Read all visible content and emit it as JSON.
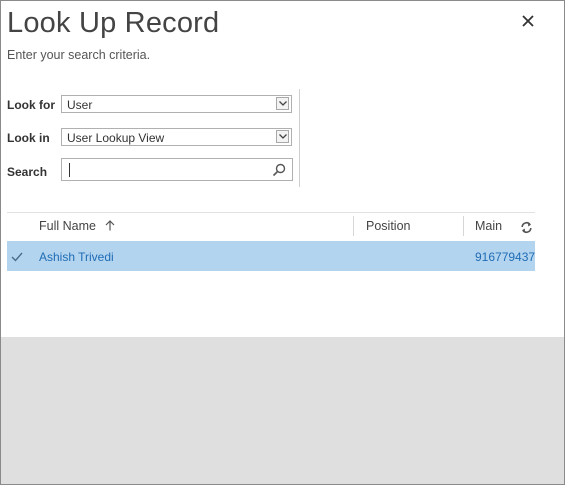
{
  "dialog": {
    "title": "Look Up Record",
    "subtitle": "Enter your search criteria.",
    "close_icon": "close-icon"
  },
  "form": {
    "look_for_label": "Look for",
    "look_for_value": "User",
    "look_in_label": "Look in",
    "look_in_value": "User Lookup View",
    "search_label": "Search",
    "search_value": ""
  },
  "grid": {
    "columns": [
      "Full Name",
      "Position",
      "Main"
    ],
    "sort_icon": "sort-ascending-icon",
    "refresh_icon": "refresh-icon",
    "rows": [
      {
        "selected": true,
        "full_name": "Ashish Trivedi",
        "position": "",
        "main": "916779437"
      }
    ]
  },
  "colors": {
    "selected_row": "#b3d4ef",
    "link_text": "#1f6cb5",
    "footer_panel": "#dfdfdf"
  }
}
